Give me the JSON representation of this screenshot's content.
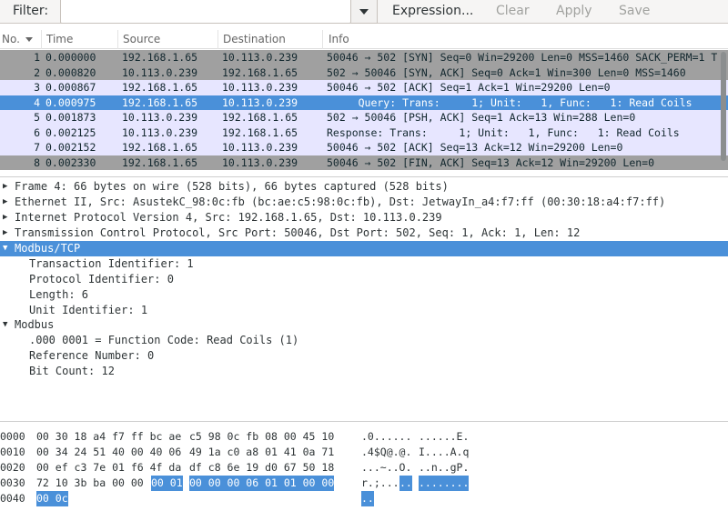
{
  "filter": {
    "label": "Filter:",
    "value": "",
    "expression_label": "Expression...",
    "clear_label": "Clear",
    "apply_label": "Apply",
    "save_label": "Save"
  },
  "packet_list": {
    "columns": [
      "No.",
      "Time",
      "Source",
      "Destination",
      "Info"
    ],
    "rows": [
      {
        "no": "1",
        "time": "0.000000",
        "src": "192.168.1.65",
        "dst": "10.113.0.239",
        "info": "50046 → 502 [SYN] Seq=0 Win=29200 Len=0 MSS=1460 SACK_PERM=1 T",
        "style": "gray"
      },
      {
        "no": "2",
        "time": "0.000820",
        "src": "10.113.0.239",
        "dst": "192.168.1.65",
        "info": "502 → 50046 [SYN, ACK] Seq=0 Ack=1 Win=300 Len=0 MSS=1460",
        "style": "gray"
      },
      {
        "no": "3",
        "time": "0.000867",
        "src": "192.168.1.65",
        "dst": "10.113.0.239",
        "info": "50046 → 502 [ACK] Seq=1 Ack=1 Win=29200 Len=0",
        "style": "lav"
      },
      {
        "no": "4",
        "time": "0.000975",
        "src": "192.168.1.65",
        "dst": "10.113.0.239",
        "info": "     Query: Trans:     1; Unit:   1, Func:   1: Read Coils",
        "style": "sel"
      },
      {
        "no": "5",
        "time": "0.001873",
        "src": "10.113.0.239",
        "dst": "192.168.1.65",
        "info": "502 → 50046 [PSH, ACK] Seq=1 Ack=13 Win=288 Len=0",
        "style": "lav"
      },
      {
        "no": "6",
        "time": "0.002125",
        "src": "10.113.0.239",
        "dst": "192.168.1.65",
        "info": "Response: Trans:     1; Unit:   1, Func:   1: Read Coils",
        "style": "lav"
      },
      {
        "no": "7",
        "time": "0.002152",
        "src": "192.168.1.65",
        "dst": "10.113.0.239",
        "info": "50046 → 502 [ACK] Seq=13 Ack=12 Win=29200 Len=0",
        "style": "lav"
      },
      {
        "no": "8",
        "time": "0.002330",
        "src": "192.168.1.65",
        "dst": "10.113.0.239",
        "info": "50046 → 502 [FIN, ACK] Seq=13 Ack=12 Win=29200 Len=0",
        "style": "gray"
      }
    ]
  },
  "details": {
    "frame": "Frame 4: 66 bytes on wire (528 bits), 66 bytes captured (528 bits)",
    "ethernet": "Ethernet II, Src: AsustekC_98:0c:fb (bc:ae:c5:98:0c:fb), Dst: JetwayIn_a4:f7:ff (00:30:18:a4:f7:ff)",
    "ip": "Internet Protocol Version 4, Src: 192.168.1.65, Dst: 10.113.0.239",
    "tcp": "Transmission Control Protocol, Src Port: 50046, Dst Port: 502, Seq: 1, Ack: 1, Len: 12",
    "modbus_tcp": {
      "title": "Modbus/TCP",
      "fields": [
        "Transaction Identifier: 1",
        "Protocol Identifier: 0",
        "Length: 6",
        "Unit Identifier: 1"
      ]
    },
    "modbus": {
      "title": "Modbus",
      "fields": [
        ".000 0001 = Function Code: Read Coils (1)",
        "Reference Number: 0",
        "Bit Count: 12"
      ]
    }
  },
  "hex": {
    "rows": [
      {
        "offset": "0000",
        "bytes_a": "00 30 18 a4 f7 ff bc ae",
        "bytes_b": "c5 98 0c fb 08 00 45 10",
        "ascii_a": ".0......",
        "ascii_b": "......E."
      },
      {
        "offset": "0010",
        "bytes_a": "00 34 24 51 40 00 40 06",
        "bytes_b": "49 1a c0 a8 01 41 0a 71",
        "ascii_a": ".4$Q@.@.",
        "ascii_b": "I....A.q"
      },
      {
        "offset": "0020",
        "bytes_a": "00 ef c3 7e 01 f6 4f da",
        "bytes_b": "df c8 6e 19 d0 67 50 18",
        "ascii_a": "...~..O.",
        "ascii_b": "..n..gP."
      },
      {
        "offset": "0030",
        "bytes_a": "72 10 3b ba 00 00",
        "bytes_a_hl": "00 01",
        "bytes_b_hl": "00 00 00 06 01 01 00 00",
        "ascii_a": "r.;...",
        "ascii_a_hl": "..",
        "ascii_b_hl": "........"
      },
      {
        "offset": "0040",
        "bytes_a_hl": "00 0c",
        "ascii_a_hl": ".."
      }
    ]
  }
}
